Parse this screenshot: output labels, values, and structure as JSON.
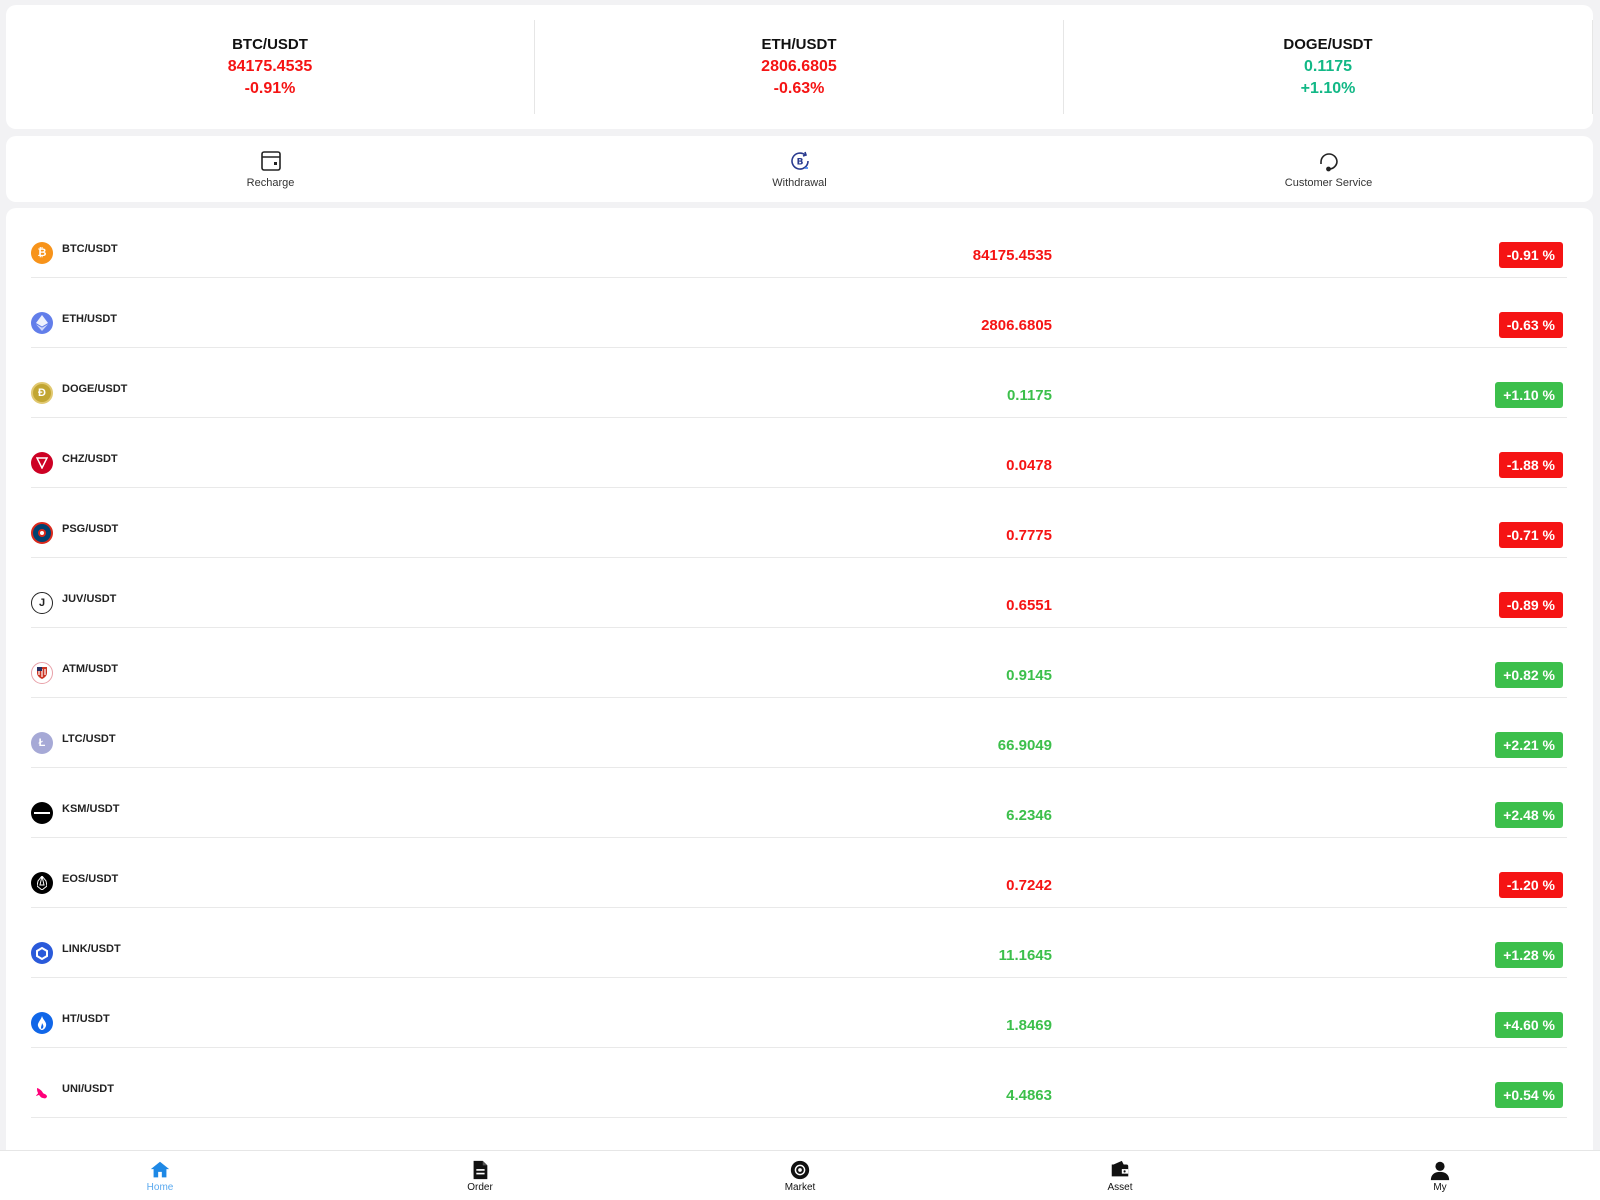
{
  "tickers": [
    {
      "pair": "BTC/USDT",
      "price": "84175.4535",
      "change": "-0.91%",
      "color": "#f51414"
    },
    {
      "pair": "ETH/USDT",
      "price": "2806.6805",
      "change": "-0.63%",
      "color": "#f51414"
    },
    {
      "pair": "DOGE/USDT",
      "price": "0.1175",
      "change": "+1.10%",
      "color": "#12b886"
    }
  ],
  "actions": [
    {
      "label": "Recharge",
      "icon": "wallet-card-icon"
    },
    {
      "label": "Withdrawal",
      "icon": "bitcoin-transfer-icon"
    },
    {
      "label": "Customer Service",
      "icon": "headset-icon"
    }
  ],
  "markets": [
    {
      "pair": "BTC/USDT",
      "price": "84175.4535",
      "change": "-0.91 %",
      "direction": "down",
      "icon": "bitcoin-icon",
      "icon_color": "#f7931a"
    },
    {
      "pair": "ETH/USDT",
      "price": "2806.6805",
      "change": "-0.63 %",
      "direction": "down",
      "icon": "ethereum-icon",
      "icon_color": "#627eea"
    },
    {
      "pair": "DOGE/USDT",
      "price": "0.1175",
      "change": "+1.10 %",
      "direction": "up",
      "icon": "dogecoin-icon",
      "icon_color": "#c2a633"
    },
    {
      "pair": "CHZ/USDT",
      "price": "0.0478",
      "change": "-1.88 %",
      "direction": "down",
      "icon": "chiliz-icon",
      "icon_color": "#cd0124"
    },
    {
      "pair": "PSG/USDT",
      "price": "0.7775",
      "change": "-0.71 %",
      "direction": "down",
      "icon": "psg-icon",
      "icon_color": "#004170"
    },
    {
      "pair": "JUV/USDT",
      "price": "0.6551",
      "change": "-0.89 %",
      "direction": "down",
      "icon": "juventus-icon",
      "icon_color": "#ffffff"
    },
    {
      "pair": "ATM/USDT",
      "price": "0.9145",
      "change": "+0.82 %",
      "direction": "up",
      "icon": "atletico-icon",
      "icon_color": "#ffffff"
    },
    {
      "pair": "LTC/USDT",
      "price": "66.9049",
      "change": "+2.21 %",
      "direction": "up",
      "icon": "litecoin-icon",
      "icon_color": "#a6a9d6"
    },
    {
      "pair": "KSM/USDT",
      "price": "6.2346",
      "change": "+2.48 %",
      "direction": "up",
      "icon": "kusama-icon",
      "icon_color": "#000000"
    },
    {
      "pair": "EOS/USDT",
      "price": "0.7242",
      "change": "-1.20 %",
      "direction": "down",
      "icon": "eos-icon",
      "icon_color": "#000000"
    },
    {
      "pair": "LINK/USDT",
      "price": "11.1645",
      "change": "+1.28 %",
      "direction": "up",
      "icon": "chainlink-icon",
      "icon_color": "#2a5ada"
    },
    {
      "pair": "HT/USDT",
      "price": "1.8469",
      "change": "+4.60 %",
      "direction": "up",
      "icon": "huobi-token-icon",
      "icon_color": "#1066e8"
    },
    {
      "pair": "UNI/USDT",
      "price": "4.4863",
      "change": "+0.54 %",
      "direction": "up",
      "icon": "uniswap-icon",
      "icon_color": "#ff007a"
    }
  ],
  "colors": {
    "down": "#f51414",
    "up": "#3cbf4b",
    "active_nav": "#5aa9ef"
  },
  "nav": [
    {
      "label": "Home",
      "icon": "home-icon",
      "active": true
    },
    {
      "label": "Order",
      "icon": "document-icon",
      "active": false
    },
    {
      "label": "Market",
      "icon": "market-icon",
      "active": false
    },
    {
      "label": "Asset",
      "icon": "wallet-icon",
      "active": false
    },
    {
      "label": "My",
      "icon": "user-icon",
      "active": false
    }
  ]
}
